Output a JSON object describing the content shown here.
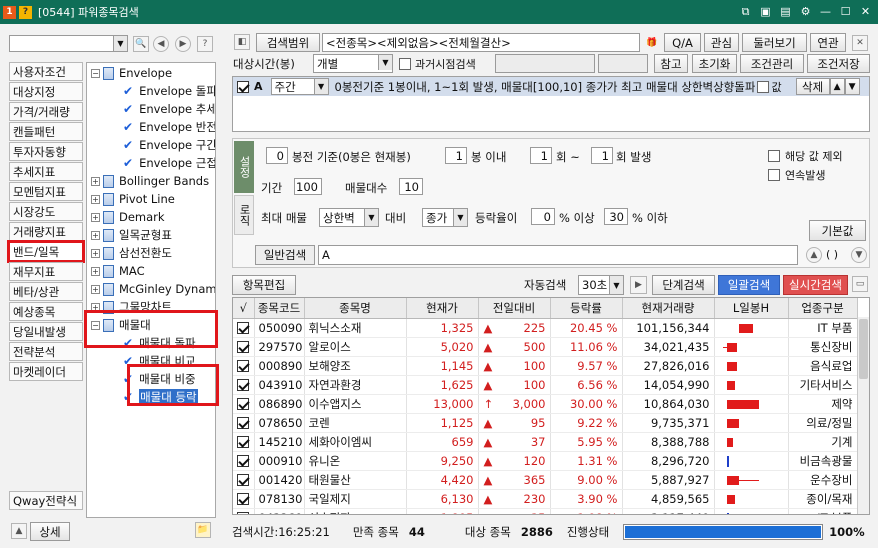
{
  "window": {
    "badge1": "1",
    "badge2": "?",
    "title": "[0544] 파워종목검색"
  },
  "left": {
    "categories": [
      "사용자조건",
      "대상지정",
      "가격/거래량",
      "캔들패턴",
      "투자자동향",
      "추세지표",
      "모멘텀지표",
      "시장강도",
      "거래량지표",
      "밴드/일목",
      "재무지표",
      "베타/상관",
      "예상종목",
      "당일내발생",
      "전략분석",
      "마켓레이더"
    ],
    "qway": "Qway전략식",
    "detail": "상세"
  },
  "tree": [
    {
      "type": "parent",
      "label": "Envelope",
      "sign": "−"
    },
    {
      "type": "leaf",
      "label": "Envelope 돌파"
    },
    {
      "type": "leaf",
      "label": "Envelope 추세"
    },
    {
      "type": "leaf",
      "label": "Envelope 반전"
    },
    {
      "type": "leaf",
      "label": "Envelope 구간"
    },
    {
      "type": "leaf",
      "label": "Envelope 근접"
    },
    {
      "type": "parent",
      "label": "Bollinger Bands",
      "sign": "+"
    },
    {
      "type": "parent",
      "label": "Pivot Line",
      "sign": "+"
    },
    {
      "type": "parent",
      "label": "Demark",
      "sign": "+"
    },
    {
      "type": "parent",
      "label": "일목균형표",
      "sign": "+"
    },
    {
      "type": "parent",
      "label": "삼선전환도",
      "sign": "+"
    },
    {
      "type": "parent",
      "label": "MAC",
      "sign": "+"
    },
    {
      "type": "parent",
      "label": "McGinley Dynamic",
      "sign": "+"
    },
    {
      "type": "parent",
      "label": "그물망차트",
      "sign": "+"
    },
    {
      "type": "parent",
      "label": "매물대",
      "sign": "−"
    },
    {
      "type": "leaf",
      "label": "매물대 돌파"
    },
    {
      "type": "leaf",
      "label": "매물대 비교"
    },
    {
      "type": "leaf",
      "label": "매물대 비중"
    },
    {
      "type": "leaf",
      "label": "매물대 등락",
      "selected": true
    }
  ],
  "top": {
    "scope_btn": "검색범위",
    "scope_value": "<전종목><제외없음><전체월결산>",
    "qa": "Q/A",
    "interest": "관심",
    "browse": "둘러보기",
    "link": "연관",
    "period_label": "대상시간(봉)",
    "period_value": "개별",
    "past_search": "과거시점검색",
    "ref": "참고",
    "reset": "초기화",
    "cond_manage": "조건관리",
    "cond_save": "조건저장"
  },
  "condition": {
    "letter": "A",
    "cycle": "주간",
    "text": "0봉전기준 1봉이내, 1~1회 발생, 매물대[100,10] 종가가 최고 매물대 상한벽상향돌파",
    "value_label": "값",
    "delete": "삭제"
  },
  "settings": {
    "tab1": "설정",
    "tab2": "로직",
    "n_before": "0",
    "before_label": "봉전 기준(0봉은 현재봉)",
    "n_within": "1",
    "within_label": "봉 이내",
    "n_from": "1",
    "from_label": "회 ~",
    "n_to": "1",
    "to_label": "회 발생",
    "exclude_label": "해당 값 제외",
    "consecutive_label": "연속발생",
    "period_label": "기간",
    "period_val": "100",
    "count_label": "매물대수",
    "count_val": "10",
    "max_label": "최대 매물",
    "upper_val": "상한벽",
    "compare_label": "대비",
    "close_val": "종가",
    "rate_label": "등락율이",
    "rate_from": "0",
    "rate_from_unit": "% 이상",
    "rate_to": "30",
    "rate_to_unit": "% 이하",
    "default_btn": "기본값"
  },
  "general": {
    "label": "일반검색",
    "value": "A"
  },
  "toolbar": {
    "edit": "항목편집",
    "auto_label": "자동검색",
    "auto_val": "30초",
    "step": "단계검색",
    "batch": "일괄검색",
    "realtime": "실시간검색"
  },
  "table": {
    "headers": [
      "√",
      "종목코드",
      "종목명",
      "현재가",
      "전일대비",
      "등락률",
      "현재거래량",
      "L일봉H",
      "업종구분"
    ],
    "rows": [
      {
        "code": "050090",
        "name": "휘닉스소재",
        "price": "1,325",
        "arrow": "▲",
        "chg": "225",
        "rate": "20.45 %",
        "vol": "101,156,344",
        "sector": "IT 부품",
        "bar": [
          24,
          14,
          0,
          0
        ]
      },
      {
        "code": "297570",
        "name": "알로이스",
        "price": "5,020",
        "arrow": "▲",
        "chg": "500",
        "rate": "11.06 %",
        "vol": "34,021,435",
        "sector": "통신장비",
        "bar": [
          12,
          10,
          -4,
          0
        ]
      },
      {
        "code": "000890",
        "name": "보해양조",
        "price": "1,145",
        "arrow": "▲",
        "chg": "100",
        "rate": "9.57 %",
        "vol": "27,826,016",
        "sector": "음식료업",
        "bar": [
          12,
          10,
          0,
          0
        ]
      },
      {
        "code": "043910",
        "name": "자연과환경",
        "price": "1,625",
        "arrow": "▲",
        "chg": "100",
        "rate": "6.56 %",
        "vol": "14,054,990",
        "sector": "기타서비스",
        "bar": [
          12,
          8,
          0,
          0
        ]
      },
      {
        "code": "086890",
        "name": "이수앱지스",
        "price": "13,000",
        "arrow": "↑",
        "chg": "3,000",
        "rate": "30.00 %",
        "vol": "10,864,030",
        "sector": "제약",
        "bar": [
          12,
          32,
          0,
          0
        ]
      },
      {
        "code": "078650",
        "name": "코렌",
        "price": "1,125",
        "arrow": "▲",
        "chg": "95",
        "rate": "9.22 %",
        "vol": "9,735,371",
        "sector": "의료/정밀",
        "bar": [
          12,
          12,
          0,
          0
        ]
      },
      {
        "code": "145210",
        "name": "세화아이엠씨",
        "price": "659",
        "arrow": "▲",
        "chg": "37",
        "rate": "5.95 %",
        "vol": "8,388,788",
        "sector": "기계",
        "bar": [
          12,
          6,
          0,
          0
        ]
      },
      {
        "code": "000910",
        "name": "유니온",
        "price": "9,250",
        "arrow": "▲",
        "chg": "120",
        "rate": "1.31 %",
        "vol": "8,296,720",
        "sector": "비금속광물",
        "bar": [
          12,
          0,
          0,
          1
        ]
      },
      {
        "code": "001420",
        "name": "태원물산",
        "price": "4,420",
        "arrow": "▲",
        "chg": "365",
        "rate": "9.00 %",
        "vol": "5,887,927",
        "sector": "운수장비",
        "bar": [
          12,
          12,
          0,
          20
        ]
      },
      {
        "code": "078130",
        "name": "국일제지",
        "price": "6,130",
        "arrow": "▲",
        "chg": "230",
        "rate": "3.90 %",
        "vol": "4,859,565",
        "sector": "종이/목재",
        "bar": [
          12,
          8,
          0,
          0
        ]
      },
      {
        "code": "043260",
        "name": "성호전자",
        "price": "1,805",
        "arrow": "▲",
        "chg": "35",
        "rate": "1.98 %",
        "vol": "3,117,449",
        "sector": "IT 부품",
        "bar": [
          12,
          0,
          0,
          2
        ]
      }
    ]
  },
  "status": {
    "time_label": "검색시간:16:25:21",
    "match_label": "만족 종목",
    "match_val": "44",
    "target_label": "대상 종목",
    "target_val": "2886",
    "progress_label": "진행상태",
    "progress": 1.0,
    "progress_text": "100%"
  }
}
